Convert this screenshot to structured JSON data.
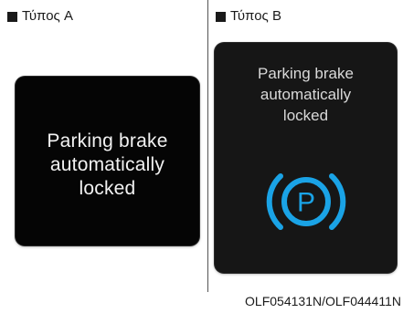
{
  "panel_a": {
    "label": "Τύπος A",
    "message_lines": [
      "Parking brake",
      "automatically",
      "locked"
    ]
  },
  "panel_b": {
    "label": "Τύπος B",
    "message_lines": [
      "Parking brake",
      "automatically",
      "locked"
    ],
    "icon": "parking-brake-icon",
    "icon_glyph": "P",
    "icon_color": "#1aa3e6"
  },
  "figure_code": "OLF054131N/OLF044411N"
}
